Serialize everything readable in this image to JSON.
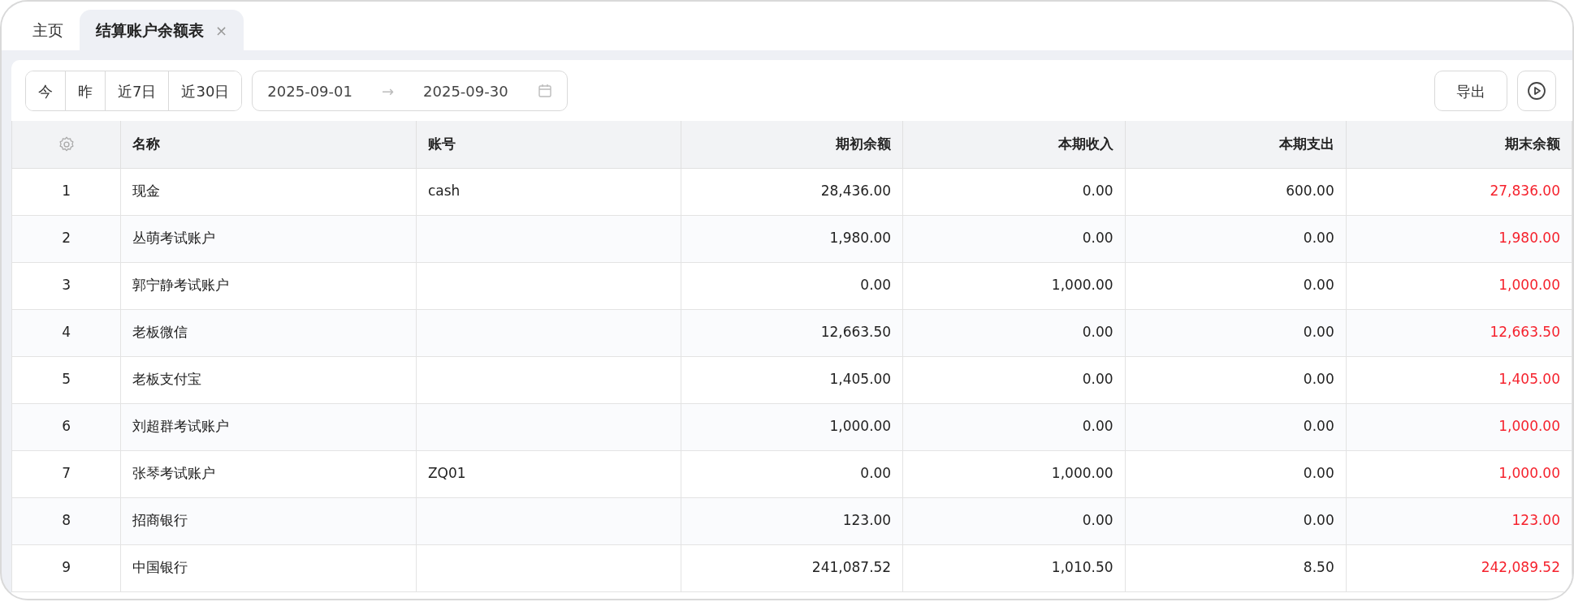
{
  "tabs": [
    {
      "label": "主页",
      "selected": false
    },
    {
      "label": "结算账户余额表",
      "selected": true,
      "close": "×"
    }
  ],
  "toolbar": {
    "periods": [
      "今",
      "昨",
      "近7日",
      "近30日"
    ],
    "date_range": {
      "start": "2025-09-01",
      "separator": "→",
      "end": "2025-09-30"
    },
    "export": "导出"
  },
  "table": {
    "columns": [
      "名称",
      "账号",
      "期初余额",
      "本期收入",
      "本期支出",
      "期末余额"
    ],
    "rows": [
      {
        "index": "1",
        "cells": [
          "现金",
          "cash",
          "28,436.00",
          "0.00",
          "600.00",
          "27,836.00"
        ]
      },
      {
        "index": "2",
        "cells": [
          "丛萌考试账户",
          "",
          "1,980.00",
          "0.00",
          "0.00",
          "1,980.00"
        ]
      },
      {
        "index": "3",
        "cells": [
          "郭宁静考试账户",
          "",
          "0.00",
          "1,000.00",
          "0.00",
          "1,000.00"
        ]
      },
      {
        "index": "4",
        "cells": [
          "老板微信",
          "",
          "12,663.50",
          "0.00",
          "0.00",
          "12,663.50"
        ]
      },
      {
        "index": "5",
        "cells": [
          "老板支付宝",
          "",
          "1,405.00",
          "0.00",
          "0.00",
          "1,405.00"
        ]
      },
      {
        "index": "6",
        "cells": [
          "刘超群考试账户",
          "",
          "1,000.00",
          "0.00",
          "0.00",
          "1,000.00"
        ]
      },
      {
        "index": "7",
        "cells": [
          "张琴考试账户",
          "ZQ01",
          "0.00",
          "1,000.00",
          "0.00",
          "1,000.00"
        ]
      },
      {
        "index": "8",
        "cells": [
          "招商银行",
          "",
          "123.00",
          "0.00",
          "0.00",
          "123.00"
        ]
      },
      {
        "index": "9",
        "cells": [
          "中国银行",
          "",
          "241,087.52",
          "1,010.50",
          "8.50",
          "242,089.52"
        ]
      }
    ]
  }
}
